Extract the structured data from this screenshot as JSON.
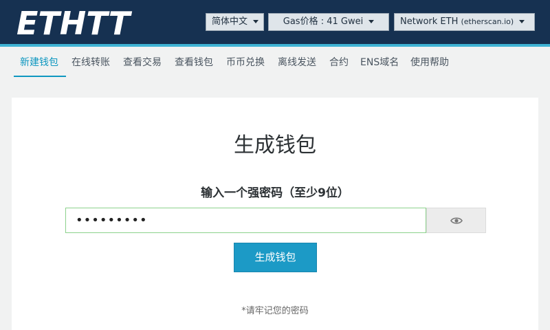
{
  "header": {
    "logo_text": "ETHTT",
    "language": "简体中文",
    "gas": "Gas价格 : 41 Gwei",
    "network_main": "Network ETH",
    "network_sub": "(etherscan.io)"
  },
  "nav": {
    "items": [
      "新建钱包",
      "在线转账",
      "查看交易",
      "查看钱包",
      "币币兑换",
      "离线发送",
      "合约",
      "ENS域名",
      "使用帮助"
    ]
  },
  "card": {
    "title": "生成钱包",
    "password_label": "输入一个强密码（至少9位）",
    "password_value": "•••••••••",
    "button_label": "生成钱包",
    "note": "*请牢记您的密码"
  },
  "colors": {
    "header_bg": "#163151",
    "accent": "#1c9ac6",
    "input_border": "#8bd18b"
  }
}
